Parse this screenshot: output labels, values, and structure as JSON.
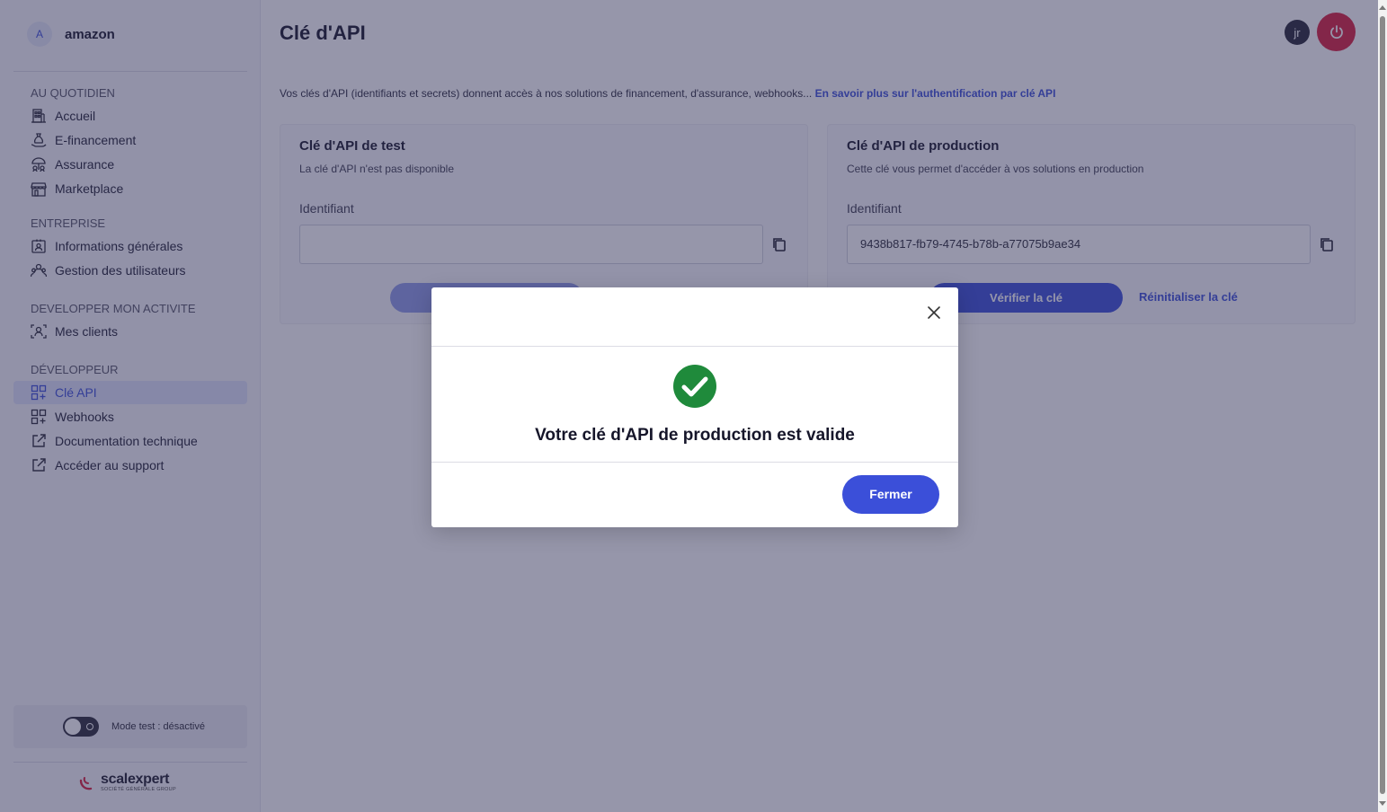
{
  "sidebar": {
    "account_initial": "A",
    "account_name": "amazon",
    "sections": {
      "daily": "AU QUOTIDIEN",
      "company": "ENTREPRISE",
      "grow": "DEVELOPPER MON ACTIVITE",
      "developer": "DÉVELOPPEUR"
    },
    "items": {
      "home": "Accueil",
      "financing": "E-financement",
      "insurance": "Assurance",
      "marketplace": "Marketplace",
      "general_info": "Informations générales",
      "users": "Gestion des utilisateurs",
      "clients": "Mes clients",
      "api_key": "Clé API",
      "webhooks": "Webhooks",
      "docs": "Documentation technique",
      "support": "Accéder au support"
    },
    "active_item": "api_key",
    "test_mode_label": "Mode test : désactivé",
    "test_mode_on": false,
    "logo_name": "scalexpert",
    "logo_sub": "SOCIÉTÉ GÉNÉRALE GROUP"
  },
  "header": {
    "title": "Clé d'API",
    "user_initials": "jr",
    "icons": {
      "power": "power-icon"
    }
  },
  "intro": {
    "text": "Vos clés d'API (identifiants et secrets) donnent accès à nos solutions de financement, d'assurance, webhooks...",
    "link": "En savoir plus sur l'authentification par clé API"
  },
  "test_card": {
    "title": "Clé d'API de test",
    "subtitle": "La clé d'API n'est pas disponible",
    "field_label": "Identifiant",
    "field_value": ""
  },
  "prod_card": {
    "title": "Clé d'API de production",
    "subtitle": "Cette clé vous permet d'accéder à vos solutions en production",
    "field_label": "Identifiant",
    "field_value": "9438b817-fb79-4745-b78b-a77075b9ae34",
    "verify_label": "Vérifier la clé",
    "reset_label": "Réinitialiser la clé"
  },
  "modal": {
    "message": "Votre clé d'API de production est valide",
    "close_label": "Fermer"
  },
  "colors": {
    "accent": "#3b4fd9",
    "power": "#d81f3c",
    "success": "#1f8a3b",
    "overlay": "rgba(45,45,85,0.5)"
  }
}
